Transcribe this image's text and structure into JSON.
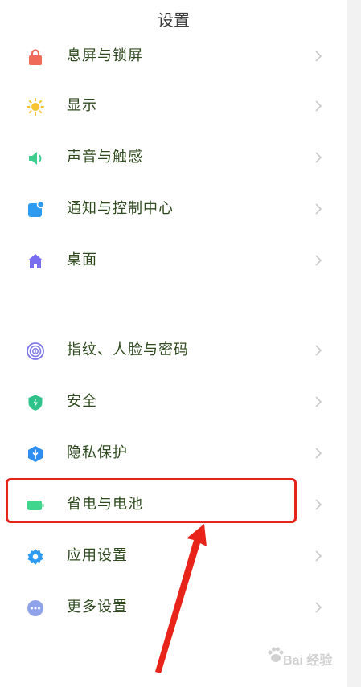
{
  "header": {
    "title": "设置"
  },
  "settings": {
    "group1": [
      {
        "label": "息屏与锁屏",
        "icon": "lock-icon",
        "color": "#f06a5a"
      },
      {
        "label": "显示",
        "icon": "sun-icon",
        "color": "#f7c531"
      },
      {
        "label": "声音与触感",
        "icon": "speaker-icon",
        "color": "#3ecf8e"
      },
      {
        "label": "通知与控制中心",
        "icon": "notification-icon",
        "color": "#2e9bf0"
      },
      {
        "label": "桌面",
        "icon": "home-icon",
        "color": "#7a6ef0"
      }
    ],
    "group2": [
      {
        "label": "指纹、人脸与密码",
        "icon": "fingerprint-icon",
        "color": "#7d75e8"
      },
      {
        "label": "安全",
        "icon": "shield-icon",
        "color": "#2fc28a"
      },
      {
        "label": "隐私保护",
        "icon": "privacy-icon",
        "color": "#2e8ff0"
      },
      {
        "label": "省电与电池",
        "icon": "battery-icon",
        "color": "#3ed68c"
      },
      {
        "label": "应用设置",
        "icon": "gear-icon",
        "color": "#2e9bf0"
      },
      {
        "label": "更多设置",
        "icon": "more-icon",
        "color": "#8fa3e8"
      }
    ]
  },
  "annotation": {
    "highlight_color": "#e8231a"
  },
  "watermark": {
    "text": "Bai 经验"
  }
}
